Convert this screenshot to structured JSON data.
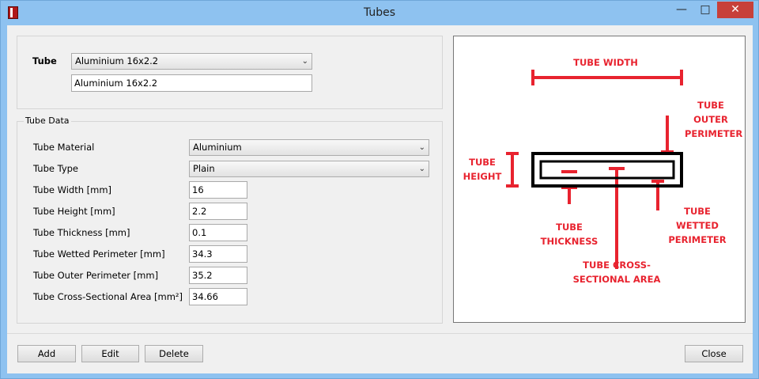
{
  "window": {
    "title": "Tubes"
  },
  "tube": {
    "label": "Tube",
    "selected": "Aluminium 16x2.2",
    "name_value": "Aluminium 16x2.2"
  },
  "tube_data": {
    "legend": "Tube Data",
    "fields": [
      {
        "label": "Tube Material",
        "value": "Aluminium"
      },
      {
        "label": "Tube Type",
        "value": "Plain"
      },
      {
        "label": "Tube Width [mm]",
        "value": "16"
      },
      {
        "label": "Tube Height [mm]",
        "value": "2.2"
      },
      {
        "label": "Tube Thickness [mm]",
        "value": "0.1"
      },
      {
        "label": "Tube Wetted Perimeter [mm]",
        "value": "34.3"
      },
      {
        "label": "Tube Outer Perimeter [mm]",
        "value": "35.2"
      },
      {
        "label": "Tube Cross-Sectional Area [mm²]",
        "value": "34.66"
      }
    ]
  },
  "diagram": {
    "accent_color": "#e8232f",
    "labels": {
      "width": "TUBE WIDTH",
      "outer_perimeter": "TUBE OUTER PERIMETER",
      "height": "TUBE HEIGHT",
      "thickness": "TUBE THICKNESS",
      "cross_section": "TUBE CROSS-SECTIONAL AREA",
      "wetted_perimeter": "TUBE WETTED PERIMETER"
    }
  },
  "buttons": {
    "add": "Add",
    "edit": "Edit",
    "delete": "Delete",
    "close": "Close"
  }
}
